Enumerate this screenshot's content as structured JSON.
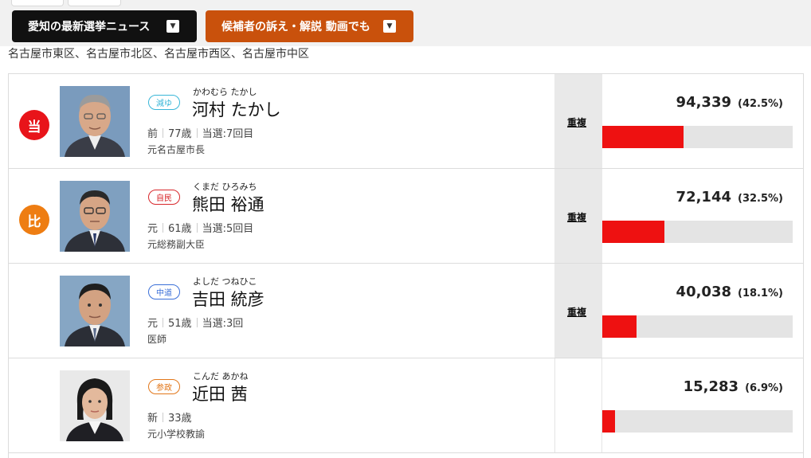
{
  "header": {
    "news_button": "愛知の最新選挙ニュース",
    "video_button": "候補者の訴え・解説 動画でも"
  },
  "district": "名古屋市東区、名古屋市北区、名古屋市西区、名古屋市中区",
  "colors": {
    "bar": "#ee1111",
    "elected": "#e8141a",
    "proportional": "#ee7d12"
  },
  "candidates": [
    {
      "badge": "当",
      "badge_color": "#e8141a",
      "party": "減ゆ",
      "party_color": "#38b6d8",
      "kana": "かわむら たかし",
      "name": "河村 たかし",
      "status": "前",
      "age": "77歳",
      "wins": "当選:7回目",
      "career": "元名古屋市長",
      "dup": "重複",
      "votes": "94,339",
      "pct": "(42.5%)",
      "share": 42.5
    },
    {
      "badge": "比",
      "badge_color": "#ee7d12",
      "party": "自民",
      "party_color": "#d8262a",
      "kana": "くまだ ひろみち",
      "name": "熊田 裕通",
      "status": "元",
      "age": "61歳",
      "wins": "当選:5回目",
      "career": "元総務副大臣",
      "dup": "重複",
      "votes": "72,144",
      "pct": "(32.5%)",
      "share": 32.5
    },
    {
      "badge": "",
      "badge_color": "",
      "party": "中道",
      "party_color": "#3a6fd8",
      "kana": "よしだ つねひこ",
      "name": "吉田 統彦",
      "status": "元",
      "age": "51歳",
      "wins": "当選:3回",
      "career": "医師",
      "dup": "重複",
      "votes": "40,038",
      "pct": "(18.1%)",
      "share": 18.1
    },
    {
      "badge": "",
      "badge_color": "",
      "party": "参政",
      "party_color": "#e2771a",
      "kana": "こんだ あかね",
      "name": "近田 茜",
      "status": "新",
      "age": "33歳",
      "wins": "",
      "career": "元小学校教諭",
      "dup": "",
      "votes": "15,283",
      "pct": "(6.9%)",
      "share": 6.9
    }
  ]
}
